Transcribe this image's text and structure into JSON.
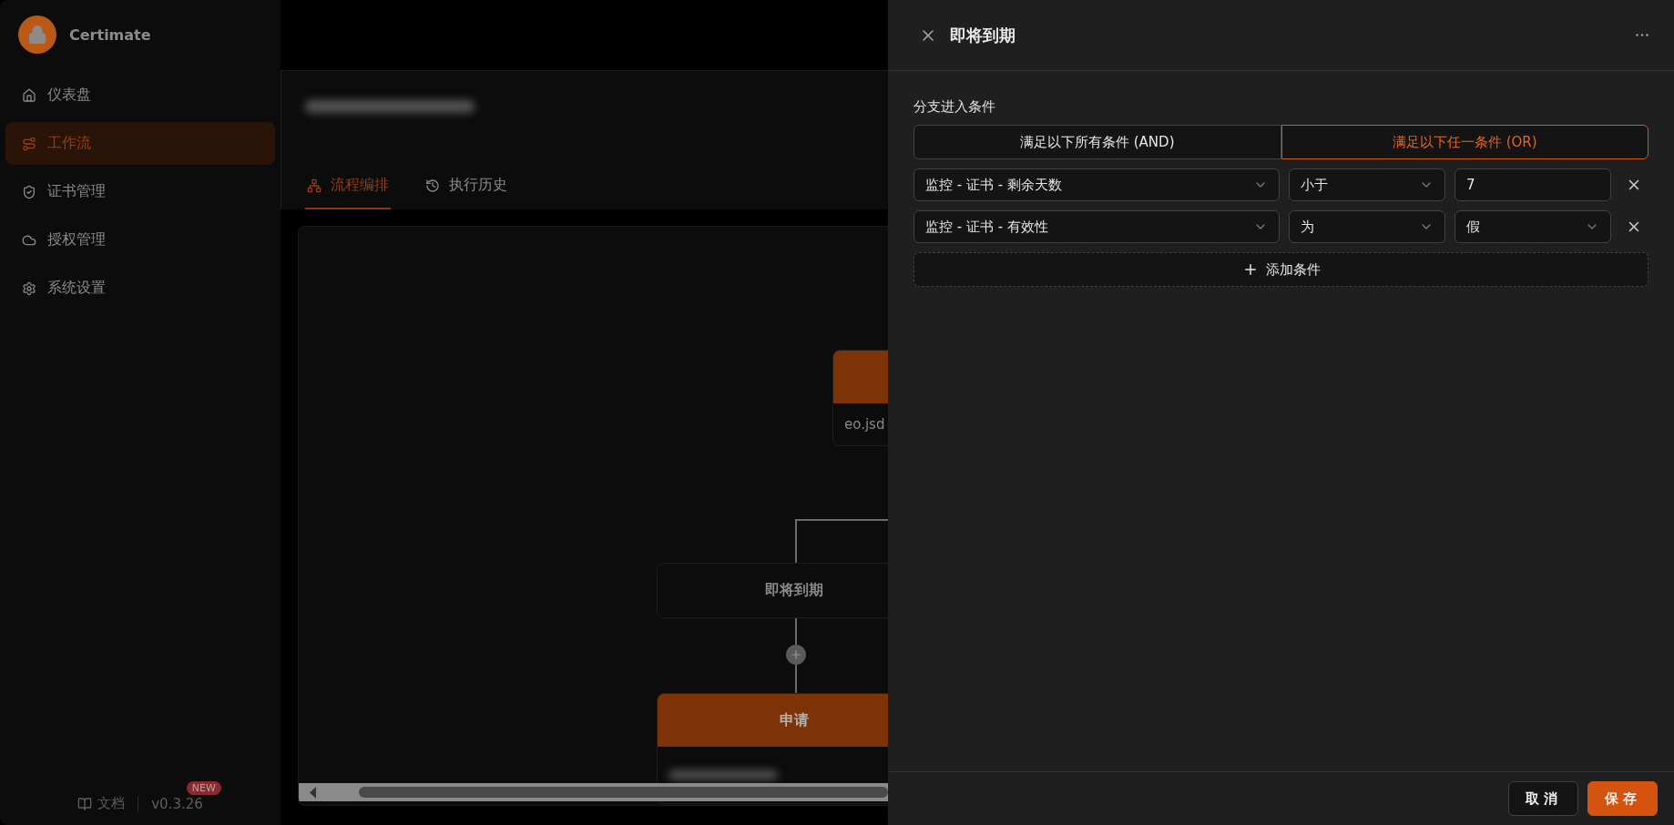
{
  "app": {
    "name": "Certimate"
  },
  "sidebar": {
    "items": [
      {
        "label": "仪表盘",
        "selected": false
      },
      {
        "label": "工作流",
        "selected": true
      },
      {
        "label": "证书管理",
        "selected": false
      },
      {
        "label": "授权管理",
        "selected": false
      },
      {
        "label": "系统设置",
        "selected": false
      }
    ],
    "footer": {
      "docs": "文档",
      "version": "v0.3.26",
      "badge": "NEW"
    }
  },
  "tabs": [
    {
      "label": "流程编排",
      "selected": true
    },
    {
      "label": "执行历史",
      "selected": false
    }
  ],
  "canvas": {
    "nodes": [
      {
        "kind": "action",
        "subtitle": "eo.jsd"
      },
      {
        "kind": "condition",
        "title": "即将到期"
      },
      {
        "kind": "action",
        "title": "申请"
      }
    ]
  },
  "drawer": {
    "title": "即将到期",
    "section_label": "分支进入条件",
    "logic_options": [
      {
        "label": "满足以下所有条件 (AND)",
        "selected": false
      },
      {
        "label": "满足以下任一条件 (OR)",
        "selected": true
      }
    ],
    "conditions": [
      {
        "field": "监控 - 证书 - 剩余天数",
        "operator": "小于",
        "value": "7",
        "kind": "input"
      },
      {
        "field": "监控 - 证书 - 有效性",
        "operator": "为",
        "value": "假",
        "kind": "select"
      }
    ],
    "add_button": "添加条件",
    "buttons": [
      {
        "label": "取消",
        "kind": "default"
      },
      {
        "label": "保存",
        "kind": "primary"
      }
    ]
  }
}
